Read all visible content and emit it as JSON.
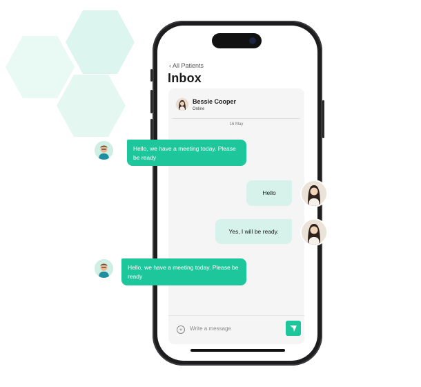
{
  "nav": {
    "back_label": "All Patients"
  },
  "header": {
    "title": "Inbox"
  },
  "contact": {
    "name": "Bessie Cooper",
    "status": "Online"
  },
  "chat": {
    "date": "16 May",
    "messages": [
      {
        "from": "doctor",
        "text": "Hello, we have a meeting today. Please be ready"
      },
      {
        "from": "patient",
        "text": "Hello"
      },
      {
        "from": "patient",
        "text": "Yes, I will be ready."
      },
      {
        "from": "doctor",
        "text": "Hello, we have a meeting today. Please be ready"
      }
    ]
  },
  "composer": {
    "placeholder": "Write a message"
  },
  "colors": {
    "accent": "#1ec69b",
    "bubble_light": "#d7f2ea",
    "hexagon": "#e4f7f1"
  },
  "icons": {
    "back": "chevron-left-icon",
    "add": "plus-icon",
    "send": "send-icon"
  }
}
